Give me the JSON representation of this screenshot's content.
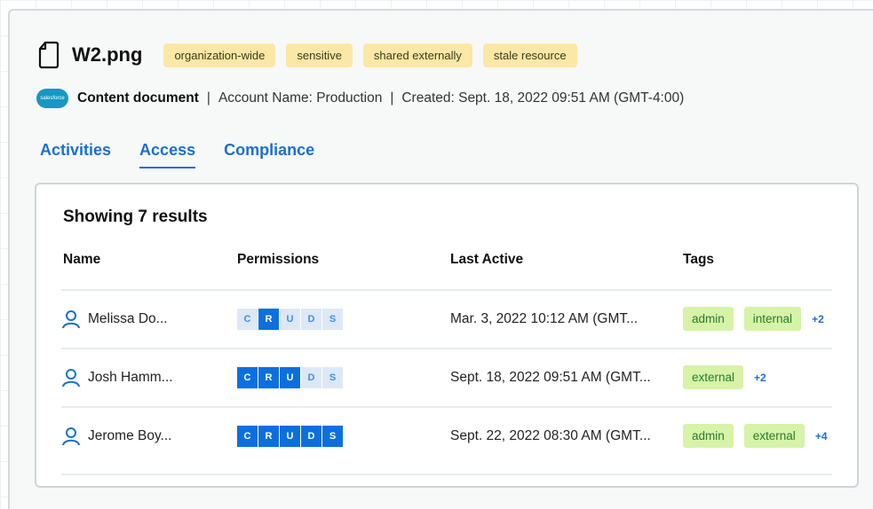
{
  "file": {
    "name": "W2.png",
    "tags": [
      "organization-wide",
      "sensitive",
      "shared externally",
      "stale resource"
    ]
  },
  "meta": {
    "logo_text": "salesforce",
    "type": "Content document",
    "account": "Account Name: Production",
    "created": "Created: Sept. 18, 2022 09:51 AM (GMT-4:00)",
    "separator": "|"
  },
  "tabs": [
    {
      "label": "Activities",
      "active": false
    },
    {
      "label": "Access",
      "active": true
    },
    {
      "label": "Compliance",
      "active": false
    }
  ],
  "table": {
    "results_label": "Showing 7 results",
    "headers": {
      "name": "Name",
      "permissions": "Permissions",
      "last_active": "Last Active",
      "tags": "Tags"
    },
    "permission_letters": [
      "C",
      "R",
      "U",
      "D",
      "S"
    ],
    "rows": [
      {
        "name": "Melissa Do...",
        "perms": [
          false,
          true,
          false,
          false,
          false
        ],
        "last_active": "Mar. 3, 2022 10:12 AM (GMT...",
        "tags": [
          "admin",
          "internal"
        ],
        "more": "+2"
      },
      {
        "name": "Josh Hamm...",
        "perms": [
          true,
          true,
          true,
          false,
          false
        ],
        "last_active": "Sept. 18, 2022 09:51 AM (GMT...",
        "tags": [
          "external"
        ],
        "more": "+2"
      },
      {
        "name": "Jerome Boy...",
        "perms": [
          true,
          true,
          true,
          true,
          true
        ],
        "last_active": "Sept. 22, 2022 08:30 AM (GMT...",
        "tags": [
          "admin",
          "external"
        ],
        "more": "+4"
      }
    ]
  },
  "colors": {
    "accent": "#1b6fd0",
    "perm_on": "#0b70de",
    "perm_off": "#dde8f7",
    "file_tag": "#fbe8a6",
    "row_tag": "#d6f3a8"
  },
  "icons": {
    "file": "document-icon",
    "logo": "salesforce-logo",
    "user": "user-icon"
  }
}
